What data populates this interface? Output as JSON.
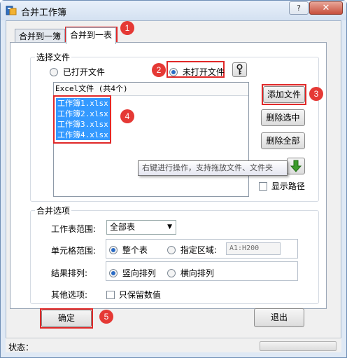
{
  "window": {
    "title": "合并工作簿",
    "help_label": "?",
    "close_label": "✕"
  },
  "tabs": [
    {
      "label": "合并到一簿",
      "active": false
    },
    {
      "label": "合并到一表",
      "active": true
    }
  ],
  "file_group": {
    "title": "选择文件",
    "radio_opened": "已打开文件",
    "radio_unopened": "未打开文件",
    "selected": "unopened",
    "key_icon": "key-icon"
  },
  "file_list": {
    "header": "Excel文件 (共4个)",
    "items": [
      "工作簿1.xlsx",
      "工作簿2.xlsx",
      "工作簿3.xlsx",
      "工作簿4.xlsx"
    ]
  },
  "side_buttons": {
    "add": "添加文件",
    "delete_selected": "删除选中",
    "delete_all": "删除全部",
    "show_path": "显示路径",
    "show_path_checked": false,
    "arrow_icon": "arrow-down-icon"
  },
  "tooltip": "右键进行操作，支持拖放文件、文件夹",
  "options_group": {
    "title": "合并选项",
    "sheet_range_label": "工作表范围:",
    "sheet_range_value": "全部表",
    "cell_range_label": "单元格范围:",
    "cell_whole": "整个表",
    "cell_specified": "指定区域:",
    "cell_range_input": "A1:H200",
    "order_label": "结果排列:",
    "order_vertical": "竖向排列",
    "order_horizontal": "横向排列",
    "other_label": "其他选项:",
    "values_only": "只保留数值",
    "values_only_checked": false
  },
  "buttons": {
    "ok": "确定",
    "exit": "退出"
  },
  "status": {
    "label": "状态："
  },
  "badges": [
    "1",
    "2",
    "3",
    "4",
    "5"
  ],
  "colors": {
    "highlight": "#e02828",
    "badge": "#e53935",
    "selection": "#3399ff",
    "arrow": "#3c9c2b"
  }
}
